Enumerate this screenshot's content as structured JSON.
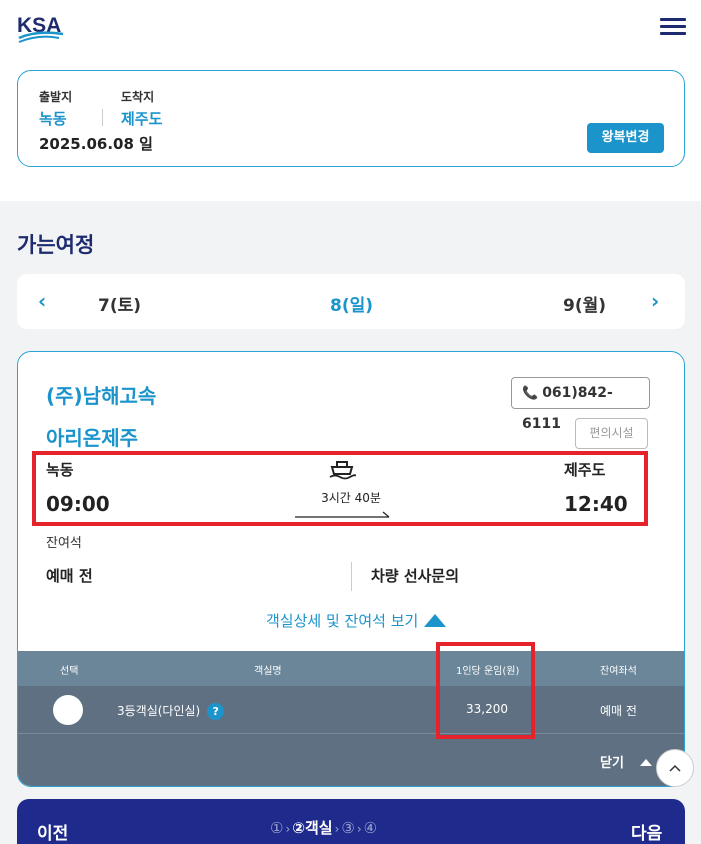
{
  "header": {
    "logo_text": "KSA"
  },
  "route": {
    "departure_label": "출발지",
    "departure_value": "녹동",
    "arrival_label": "도착지",
    "arrival_value": "제주도",
    "date": "2025.06.08 일",
    "roundtrip_button": "왕복변경"
  },
  "section_title": "가는여정",
  "dates": {
    "prev": "7(토)",
    "current": "8(일)",
    "next": "9(월)"
  },
  "ship": {
    "company": "(주)남해고속",
    "name": "아리온제주",
    "phone": "061)842-6111",
    "facility_button": "편의시설",
    "departure_port": "녹동",
    "departure_time": "09:00",
    "arrival_port": "제주도",
    "arrival_time": "12:40",
    "duration": "3시간 40분",
    "remain_label": "잔여석",
    "sale_status": "예매 전",
    "vehicle_status": "차량 선사문의",
    "detail_link": "객실상세 및 잔여석 보기"
  },
  "table": {
    "headers": [
      "선택",
      "객실명",
      "1인당 운임(원)",
      "잔여좌석"
    ],
    "rows": [
      {
        "name": "3등객실(다인실)",
        "help": "?",
        "fare": "33,200",
        "remain": "예매 전"
      }
    ],
    "close_label": "닫기"
  },
  "footer": {
    "prev": "이전",
    "next": "다음",
    "step1": "①",
    "step2": "②",
    "step2_label": "객실",
    "step3": "③",
    "step4": "④",
    "sep": "›"
  },
  "colors": {
    "accent": "#1b94cc",
    "navy": "#1e2b8c",
    "highlight": "#e4232b"
  }
}
